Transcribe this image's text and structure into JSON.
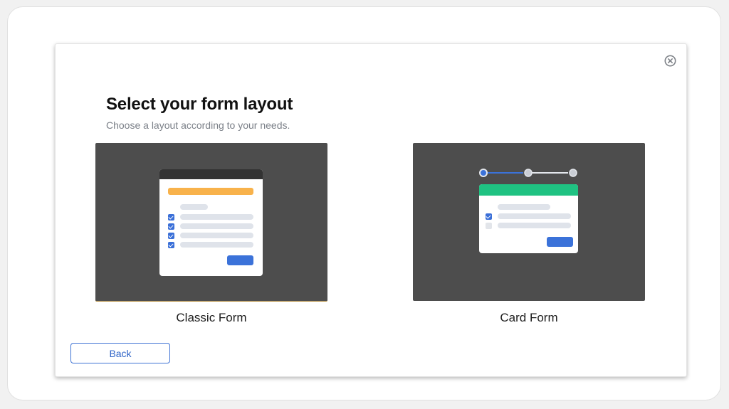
{
  "dialog": {
    "title": "Select your form layout",
    "subtitle": "Choose a layout according to your needs.",
    "close_icon": "close-circle-icon",
    "back_label": "Back"
  },
  "options": [
    {
      "label": "Classic Form",
      "accent_color": "#f8b24b"
    },
    {
      "label": "Card Form",
      "accent_color": "#1fc282"
    }
  ],
  "colors": {
    "primary": "#3b72d9",
    "preview_background": "#4d4d4d",
    "card_header": "#1fc282",
    "classic_header": "#333333",
    "classic_accent": "#f8b24b"
  }
}
